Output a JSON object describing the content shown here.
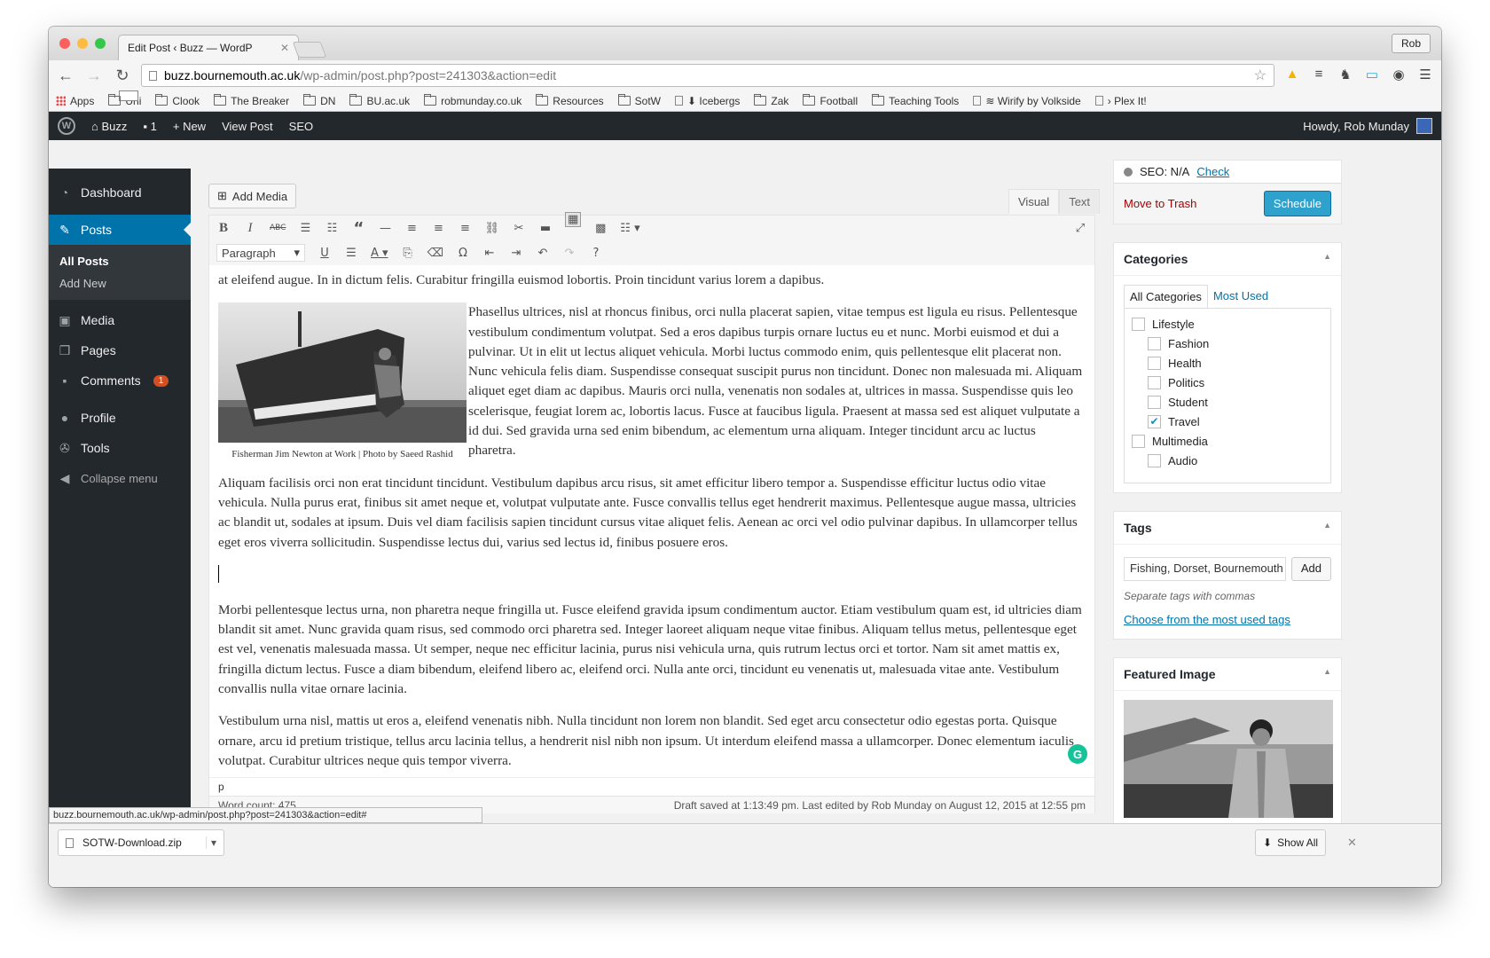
{
  "browser": {
    "tab_title": "Edit Post ‹ Buzz — WordP",
    "profile": "Rob",
    "url_host": "buzz.bournemouth.ac.uk",
    "url_path": "/wp-admin/post.php?post=241303&action=edit",
    "bookmarks": [
      {
        "label": "Apps",
        "icon": "apps-grid-icon"
      },
      {
        "label": "Uni",
        "icon": "folder-icon"
      },
      {
        "label": "Clook",
        "icon": "folder-icon"
      },
      {
        "label": "The Breaker",
        "icon": "folder-icon"
      },
      {
        "label": "DN",
        "icon": "folder-icon"
      },
      {
        "label": "BU.ac.uk",
        "icon": "folder-icon"
      },
      {
        "label": "robmunday.co.uk",
        "icon": "folder-icon"
      },
      {
        "label": "Resources",
        "icon": "folder-icon"
      },
      {
        "label": "SotW",
        "icon": "folder-icon"
      },
      {
        "label": "⬇ Icebergs",
        "icon": "page-icon"
      },
      {
        "label": "Zak",
        "icon": "folder-icon"
      },
      {
        "label": "Football",
        "icon": "folder-icon"
      },
      {
        "label": "Teaching Tools",
        "icon": "folder-icon"
      },
      {
        "label": "≋ Wirify by Volkside",
        "icon": "page-icon"
      },
      {
        "label": "› Plex It!",
        "icon": "page-icon"
      }
    ],
    "status_url": "buzz.bournemouth.ac.uk/wp-admin/post.php?post=241303&action=edit#",
    "download_file": "SOTW-Download.zip",
    "show_all": "Show All"
  },
  "adminbar": {
    "site": "Buzz",
    "comments": "1",
    "new": "New",
    "view_post": "View Post",
    "seo": "SEO",
    "howdy": "Howdy, Rob Munday"
  },
  "sidebar": {
    "items": [
      {
        "label": "Dashboard",
        "icon": "dashboard-icon"
      },
      {
        "label": "Posts",
        "icon": "pin-icon"
      },
      {
        "label": "Media",
        "icon": "media-icon"
      },
      {
        "label": "Pages",
        "icon": "pages-icon"
      },
      {
        "label": "Comments",
        "icon": "comment-icon",
        "badge": "1"
      },
      {
        "label": "Profile",
        "icon": "user-icon"
      },
      {
        "label": "Tools",
        "icon": "wrench-icon"
      },
      {
        "label": "Collapse menu",
        "icon": "collapse-icon"
      }
    ],
    "sub": [
      "All Posts",
      "Add New"
    ]
  },
  "editor": {
    "add_media": "Add Media",
    "visual": "Visual",
    "text": "Text",
    "format": "Paragraph",
    "cut_line": "at eleifend augue. In in dictum felis. Curabitur fringilla euismod lobortis. Proin tincidunt varius lorem a dapibus.",
    "caption": "Fisherman Jim Newton at Work | Photo by Saeed Rashid",
    "paragraphs": [
      "Phasellus ultrices, nisl at rhoncus finibus, orci nulla placerat sapien, vitae tempus est ligula eu risus. Pellentesque vestibulum condimentum volutpat. Sed a eros dapibus turpis ornare luctus eu et nunc. Morbi euismod et dui a pulvinar. Ut in elit ut lectus aliquet vehicula. Morbi luctus commodo enim, quis pellentesque elit placerat non. Nunc vehicula felis diam. Suspendisse consequat suscipit purus non tincidunt. Donec non malesuada mi. Aliquam aliquet eget diam ac dapibus. Mauris orci nulla, venenatis non sodales at, ultrices in massa. Suspendisse quis leo scelerisque, feugiat lorem ac, lobortis lacus. Fusce at faucibus ligula. Praesent at massa sed est aliquet vulputate a id dui. Sed gravida urna sed enim bibendum, ac elementum urna aliquam. Integer tincidunt arcu ac luctus pharetra.",
      "Aliquam facilisis orci non erat tincidunt tincidunt. Vestibulum dapibus arcu risus, sit amet efficitur libero tempor a. Suspendisse efficitur luctus odio vitae vehicula. Nulla purus erat, finibus sit amet neque et, volutpat vulputate ante. Fusce convallis tellus eget hendrerit maximus. Pellentesque augue massa, ultricies ac blandit ut, sodales at ipsum. Duis vel diam facilisis sapien tincidunt cursus vitae aliquet felis. Aenean ac orci vel odio pulvinar dapibus. In ullamcorper tellus eget eros viverra sollicitudin. Suspendisse lectus dui, varius sed lectus id, finibus posuere eros.",
      "Morbi pellentesque lectus urna, non pharetra neque fringilla ut. Fusce eleifend gravida ipsum condimentum auctor. Etiam vestibulum quam est, id ultricies diam blandit sit amet. Nunc gravida quam risus, sed commodo orci pharetra sed. Integer laoreet aliquam neque vitae finibus. Aliquam tellus metus, pellentesque eget est vel, venenatis malesuada massa. Ut semper, neque nec efficitur lacinia, purus nisi vehicula urna, quis rutrum lectus orci et tortor. Nam sit amet mattis ex, fringilla dictum lectus. Fusce a diam bibendum, eleifend libero ac, eleifend orci. Nulla ante orci, tincidunt eu venenatis ut, malesuada vitae ante. Vestibulum convallis nulla vitae ornare lacinia.",
      "Vestibulum urna nisl, mattis ut eros a, eleifend venenatis nibh. Nulla tincidunt non lorem non blandit. Sed eget arcu consectetur odio egestas porta. Quisque ornare, arcu id pretium tristique, tellus arcu lacinia tellus, a hendrerit nisl nibh non ipsum. Ut interdum eleifend massa a ullamcorper. Donec elementum iaculis volutpat. Curabitur ultrices neque quis tempor viverra."
    ],
    "path": "p",
    "word_count": "Word count: 475",
    "draft_saved": "Draft saved at 1:13:49 pm. Last edited by Rob Munday on August 12, 2015 at 12:55 pm"
  },
  "publish": {
    "seo_label": "SEO: N/A",
    "seo_check": "Check",
    "trash": "Move to Trash",
    "schedule": "Schedule"
  },
  "categories": {
    "title": "Categories",
    "tab_all": "All Categories",
    "tab_used": "Most Used",
    "items": [
      {
        "label": "Lifestyle",
        "checked": false,
        "child": false
      },
      {
        "label": "Fashion",
        "checked": false,
        "child": true
      },
      {
        "label": "Health",
        "checked": false,
        "child": true
      },
      {
        "label": "Politics",
        "checked": false,
        "child": true
      },
      {
        "label": "Student",
        "checked": false,
        "child": true
      },
      {
        "label": "Travel",
        "checked": true,
        "child": true
      },
      {
        "label": "Multimedia",
        "checked": false,
        "child": false
      },
      {
        "label": "Audio",
        "checked": false,
        "child": true
      }
    ]
  },
  "tags": {
    "title": "Tags",
    "value": "Fishing, Dorset, Bournemouth",
    "add": "Add",
    "howto": "Separate tags with commas",
    "choose": "Choose from the most used tags"
  },
  "featured": {
    "title": "Featured Image"
  }
}
